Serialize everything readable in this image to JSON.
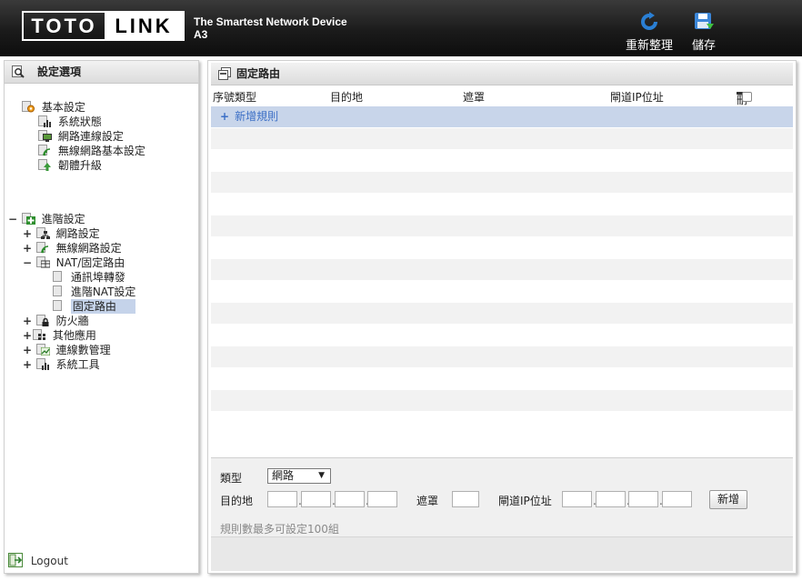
{
  "header": {
    "logo_left": "TOTO",
    "logo_right": "LINK",
    "tagline": "The Smartest Network Device",
    "model": "A3",
    "refresh_label": "重新整理",
    "save_label": "儲存"
  },
  "sidebar": {
    "title": "設定選項",
    "groups": [
      {
        "label": "基本設定",
        "items": [
          "系統狀態",
          "網路連線設定",
          "無線網路基本設定",
          "韌體升級"
        ]
      },
      {
        "label": "進階設定",
        "toggle": "−",
        "items": [
          {
            "label": "網路設定",
            "toggle": "+"
          },
          {
            "label": "無線網路設定",
            "toggle": "+"
          },
          {
            "label": "NAT/固定路由",
            "toggle": "−",
            "children": [
              "通訊埠轉發",
              "進階NAT設定",
              "固定路由"
            ]
          },
          {
            "label": "防火牆",
            "toggle": "+"
          },
          {
            "label": "其他應用",
            "toggle": "+"
          },
          {
            "label": "連線數管理",
            "toggle": "+"
          },
          {
            "label": "系統工具",
            "toggle": "+"
          }
        ]
      }
    ],
    "selected": "固定路由",
    "logout_label": "Logout"
  },
  "main": {
    "title": "固定路由",
    "columns": [
      "序號類型",
      "目的地",
      "遮罩",
      "閘道IP位址",
      "刪除"
    ],
    "add_rule_label": "新增規則",
    "empty_rows": 14,
    "form": {
      "type_label": "類型",
      "type_value": "網路",
      "dest_label": "目的地",
      "mask_label": "遮罩",
      "gateway_label": "閘道IP位址",
      "add_button": "新增",
      "note": "規則數最多可設定100組"
    }
  }
}
